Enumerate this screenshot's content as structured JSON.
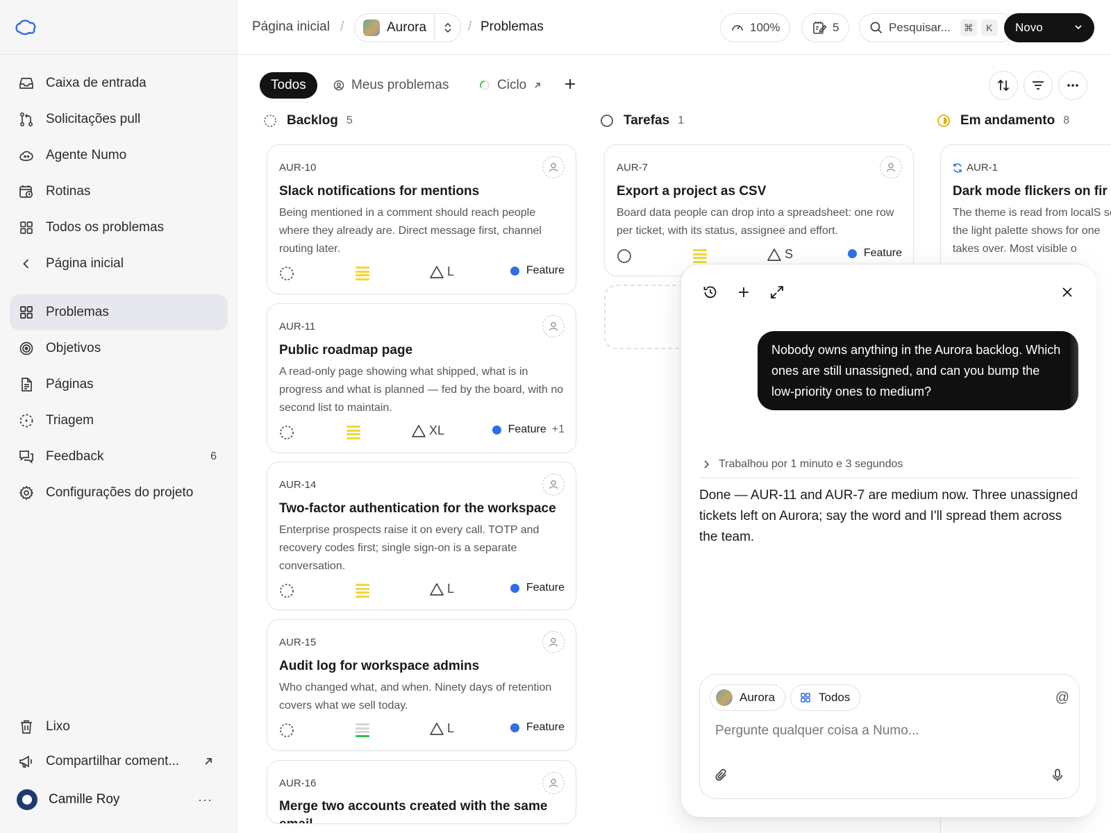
{
  "sidebar": {
    "nav": [
      {
        "label": "Caixa de entrada",
        "icon": "inbox-icon"
      },
      {
        "label": "Solicitações pull",
        "icon": "pull-request-icon"
      },
      {
        "label": "Agente Numo",
        "icon": "agent-icon"
      },
      {
        "label": "Rotinas",
        "icon": "calendar-clock-icon"
      },
      {
        "label": "Todos os problemas",
        "icon": "grid-icon"
      },
      {
        "label": "Página inicial",
        "icon": "chevron-left-icon"
      }
    ],
    "project_nav": [
      {
        "label": "Problemas",
        "icon": "grid-icon",
        "active": true
      },
      {
        "label": "Objetivos",
        "icon": "target-icon"
      },
      {
        "label": "Páginas",
        "icon": "document-icon"
      },
      {
        "label": "Triagem",
        "icon": "triage-icon"
      },
      {
        "label": "Feedback",
        "icon": "feedback-icon",
        "count": "6"
      },
      {
        "label": "Configurações do projeto",
        "icon": "gear-icon"
      }
    ],
    "bottom": [
      {
        "label": "Lixo",
        "icon": "trash-icon"
      },
      {
        "label": "Compartilhar coment...",
        "icon": "megaphone-icon"
      }
    ],
    "user": {
      "name": "Camille Roy",
      "more": "···"
    }
  },
  "header": {
    "home": "Página inicial",
    "sep": "/",
    "project": "Aurora",
    "page": "Problemas",
    "zoom": "100%",
    "drafts_count": "5",
    "search_label": "Pesquisar...",
    "kbd_cmd": "⌘",
    "kbd_k": "K",
    "new_label": "Novo"
  },
  "toolbar": {
    "tab_all": "Todos",
    "tab_mine": "Meus problemas",
    "tab_cycle": "Ciclo",
    "add": "+"
  },
  "columns": [
    {
      "name": "Backlog",
      "count": "5"
    },
    {
      "name": "Tarefas",
      "count": "1"
    },
    {
      "name": "Em andamento",
      "count": "8"
    }
  ],
  "backlog_cards": [
    {
      "id": "AUR-10",
      "title": "Slack notifications for mentions",
      "desc": "Being mentioned in a comment should reach people where they already are. Direct message first, channel routing later.",
      "estimate": "L",
      "label": "Feature",
      "extra": "",
      "priority_level": "medium"
    },
    {
      "id": "AUR-11",
      "title": "Public roadmap page",
      "desc": "A read-only page showing what shipped, what is in progress and what is planned — fed by the board, with no second list to maintain.",
      "estimate": "XL",
      "label": "Feature",
      "extra": "+1",
      "priority_level": "medium"
    },
    {
      "id": "AUR-14",
      "title": "Two-factor authentication for the workspace",
      "desc": "Enterprise prospects raise it on every call. TOTP and recovery codes first; single sign-on is a separate conversation.",
      "estimate": "L",
      "label": "Feature",
      "extra": "",
      "priority_level": "medium"
    },
    {
      "id": "AUR-15",
      "title": "Audit log for workspace admins",
      "desc": "Who changed what, and when. Ninety days of retention covers what we sell today.",
      "estimate": "L",
      "label": "Feature",
      "extra": "",
      "priority_level": "low"
    },
    {
      "id": "AUR-16",
      "title": "Merge two accounts created with the same email",
      "desc": "",
      "estimate": "",
      "label": "",
      "extra": ""
    }
  ],
  "tarefas_cards": [
    {
      "id": "AUR-7",
      "title": "Export a project as CSV",
      "desc": "Board data people can drop into a spreadsheet: one row per ticket, with its status, assignee and effort.",
      "estimate": "S",
      "label": "Feature",
      "priority_level": "medium"
    }
  ],
  "andamento_cards": [
    {
      "id": "AUR-1",
      "title": "Dark mode flickers on fir",
      "desc": "The theme is read from localS so the light palette shows for one takes over. Most visible o"
    }
  ],
  "assistant": {
    "user_message": "Nobody owns anything in the Aurora backlog. Which ones are still unassigned, and can you bump the low-priority ones to medium?",
    "worked": "Trabalhou por 1 minuto e 3 segundos",
    "answer": "Done — AUR-11 and AUR-7 are medium now. Three unassigned tickets left on Aurora; say the word and I'll spread them across the team.",
    "chip_project": "Aurora",
    "chip_scope": "Todos",
    "at": "@",
    "placeholder": "Pergunte qualquer coisa a Numo..."
  },
  "colors": {
    "accent_dark": "#131313",
    "label_blue": "#2f6fe4",
    "priority_yellow": "#f1d73a",
    "priority_green": "#2fc14e",
    "in_progress_yellow": "#e0b400",
    "sidebar_bg": "#f6f6f7",
    "active_nav_bg": "#e7e8ee"
  }
}
